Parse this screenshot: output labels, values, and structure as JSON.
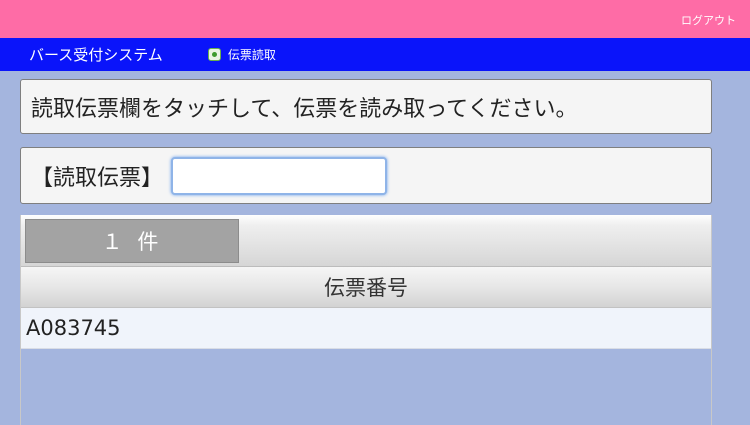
{
  "header": {
    "logout_label": "ログアウト",
    "color": "#fe6ca6"
  },
  "nav": {
    "app_title": "バース受付システム",
    "tab_label": "伝票読取",
    "tab_icon": "gear-icon",
    "color": "#0a14fa"
  },
  "instruction": {
    "text": "読取伝票欄をタッチして、伝票を読み取ってください。"
  },
  "input": {
    "label": "【読取伝票】",
    "value": "",
    "placeholder": ""
  },
  "list": {
    "count_label": "１ 件",
    "column_header": "伝票番号",
    "rows": [
      {
        "slip_number": "A083745"
      }
    ]
  },
  "colors": {
    "background": "#a4b5de",
    "panel": "#f5f5f5",
    "row": "#f0f4fb"
  }
}
